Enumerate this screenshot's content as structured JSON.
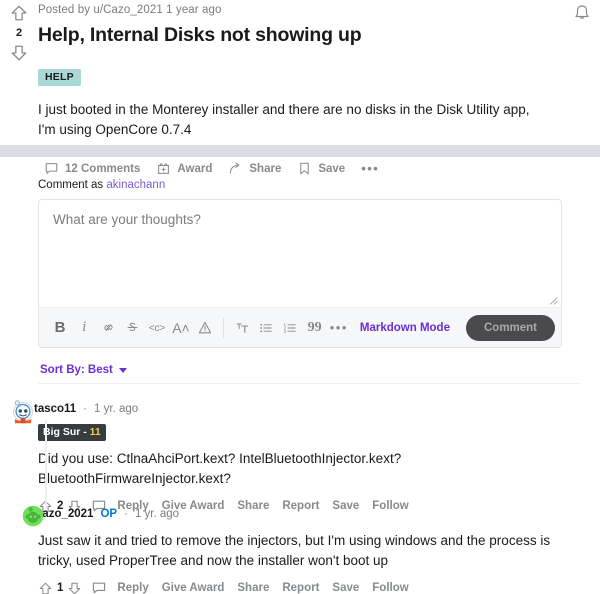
{
  "post": {
    "vote": {
      "up_icon": "upvote-arrow-icon",
      "score": "2",
      "down_icon": "downvote-arrow-icon"
    },
    "meta_prefix": "Posted by",
    "author": "u/Cazo_2021",
    "age": "1 year ago",
    "title": "Help, Internal Disks not showing up",
    "flair": "HELP",
    "flair_bg": "#a9d8d6",
    "body": "I just booted in the Monterey installer and there are no disks in the Disk Utility app, I'm using OpenCore 0.7.4",
    "actions": {
      "comments": "12 Comments",
      "award": "Award",
      "share": "Share",
      "save": "Save",
      "more": "•••"
    }
  },
  "notifications": {
    "icon": "bell-icon"
  },
  "composer": {
    "label_prefix": "Comment as",
    "username": "akinachann",
    "placeholder": "What are your thoughts?",
    "value": "",
    "toolbar": [
      {
        "name": "bold-icon",
        "glyph": "B",
        "cls": "bold"
      },
      {
        "name": "italic-icon",
        "glyph": "i",
        "cls": "ital"
      },
      {
        "name": "link-icon",
        "glyph": "",
        "cls": "svg-link"
      },
      {
        "name": "strikethrough-icon",
        "glyph": "S̶",
        "cls": "strike"
      },
      {
        "name": "inline-code-icon",
        "glyph": "<c>",
        "cls": "code"
      },
      {
        "name": "superscript-icon",
        "glyph": "A˄",
        "cls": "sup"
      },
      {
        "name": "spoiler-icon",
        "glyph": "",
        "cls": "svg-spoiler"
      },
      {
        "name": "heading-icon",
        "glyph": "",
        "cls": "svg-heading"
      },
      {
        "name": "bulleted-list-icon",
        "glyph": "",
        "cls": "svg-ul"
      },
      {
        "name": "numbered-list-icon",
        "glyph": "",
        "cls": "svg-ol"
      },
      {
        "name": "quote-icon",
        "glyph": "99",
        "cls": "quote"
      },
      {
        "name": "more-options-icon",
        "glyph": "•••",
        "cls": "more"
      }
    ],
    "markdown_mode": "Markdown Mode",
    "submit_label": "Comment",
    "submit_bg": "#4a4a4c",
    "accent": "#6a2fd4"
  },
  "sort": {
    "label": "Sort By: Best",
    "caret": "chevron-down-icon"
  },
  "comments": [
    {
      "avatar": "snoo-astronaut-avatar",
      "author": "tasco11",
      "op": "",
      "separator": "·",
      "age": "1 yr. ago",
      "flair_text": "Big Sur - ",
      "flair_num": "11",
      "flair_bg": "#373c3f",
      "text": "Did you use: CtlnaAhciPort.kext? IntelBluetoothInjector.kext? BluetoothFirmwareInjector.kext?",
      "score": "2",
      "actions": [
        "Reply",
        "Give Award",
        "Share",
        "Report",
        "Save",
        "Follow"
      ]
    },
    {
      "avatar": "snoo-green-avatar",
      "author": "Cazo_2021",
      "op": "OP",
      "separator": "·",
      "age": "1 yr. ago",
      "flair_text": "",
      "flair_num": "",
      "flair_bg": "",
      "text": "Just saw it and tried to remove the injectors, but I'm using windows and the process is tricky, used ProperTree and now the installer won't boot up",
      "score": "1",
      "actions": [
        "Reply",
        "Give Award",
        "Share",
        "Report",
        "Save",
        "Follow"
      ]
    }
  ]
}
